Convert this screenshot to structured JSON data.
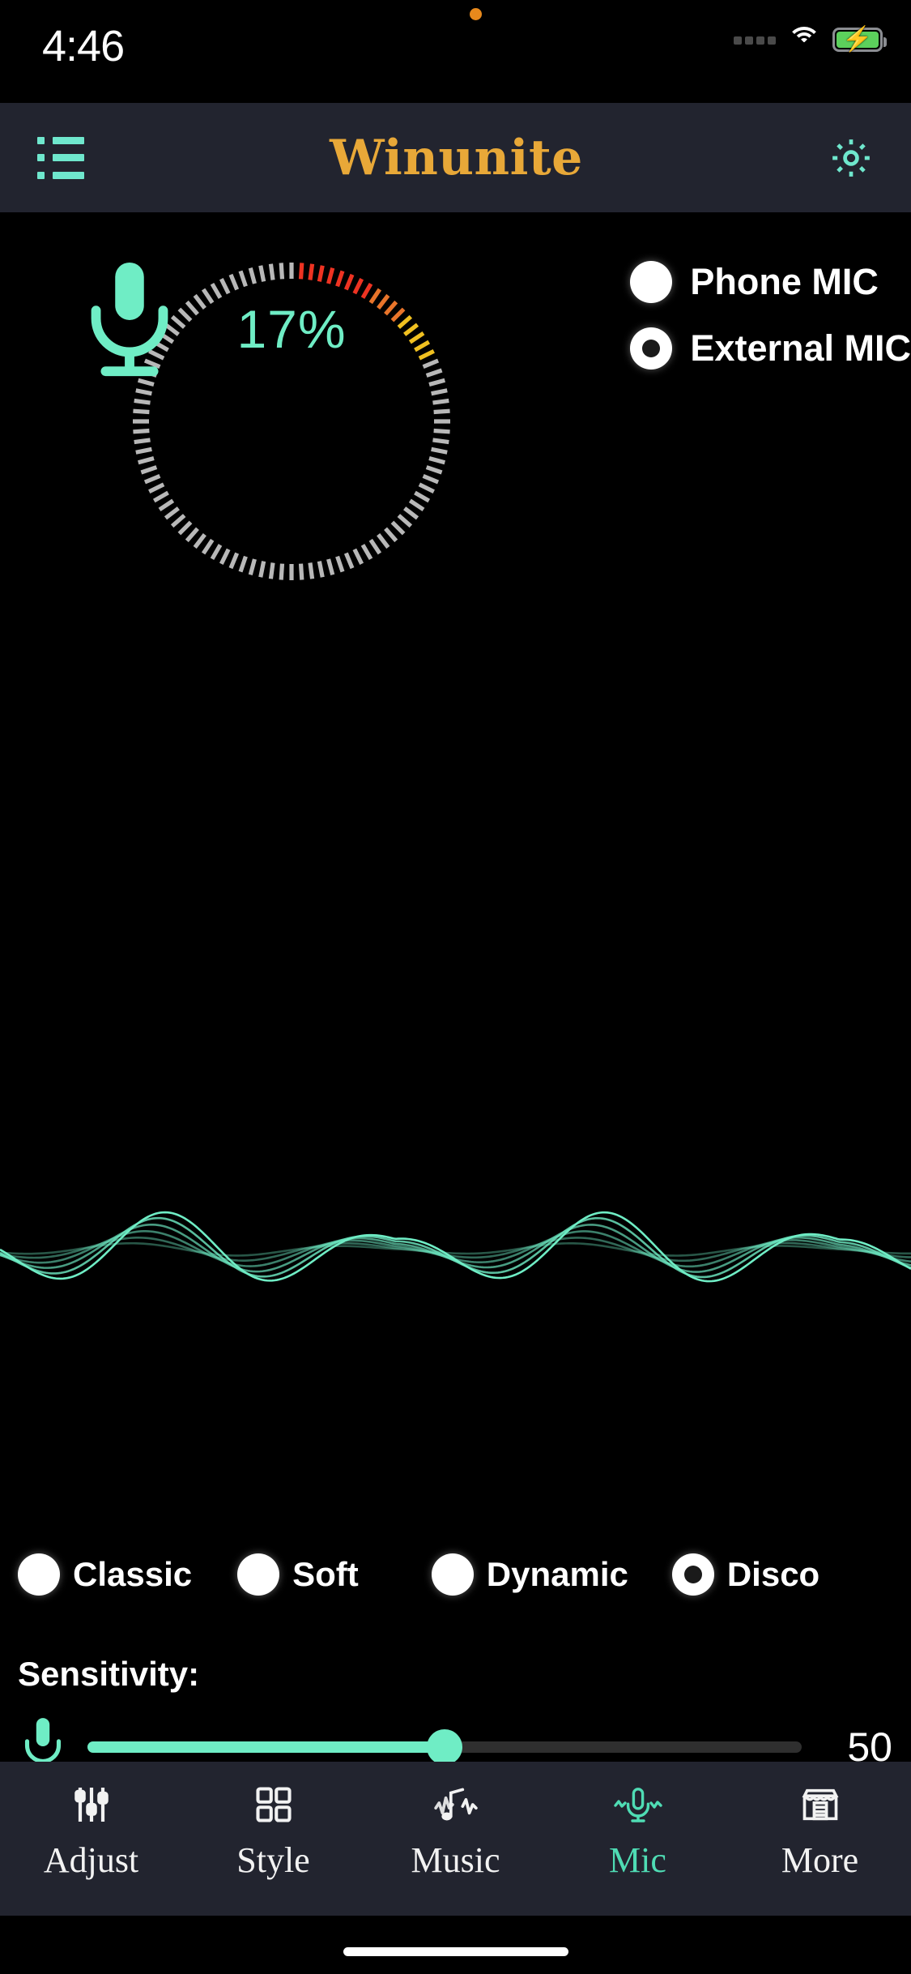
{
  "status_bar": {
    "time": "4:46",
    "recording_dot": "orange-dot-icon",
    "signal_icon": "signal-dots-icon",
    "wifi_icon": "wifi-icon",
    "battery_icon": "battery-charging-icon",
    "dot_color": "#e8891c",
    "battery_color": "#5cd05c"
  },
  "header": {
    "menu_icon": "list-menu-icon",
    "title": "Winunite",
    "settings_icon": "gear-icon",
    "title_color": "#e8a838",
    "icon_color": "#6fe7cd",
    "bg": "#22242f"
  },
  "mic_source": {
    "options": [
      {
        "label": "Phone MIC",
        "selected": false
      },
      {
        "label": "External MIC",
        "selected": true
      }
    ]
  },
  "gauge": {
    "percent_label": "17%",
    "percent_value": 17,
    "mic_icon": "microphone-icon",
    "accent": "#6fedc5",
    "tick_gray": "#b8b8b8",
    "tick_hot": "#ee3322",
    "tick_warm": "#f0c020"
  },
  "waveform": {
    "icon": "audio-waveform",
    "color": "#6fedc5"
  },
  "style_modes": {
    "options": [
      {
        "label": "Classic",
        "selected": false
      },
      {
        "label": "Soft",
        "selected": false
      },
      {
        "label": "Dynamic",
        "selected": false
      },
      {
        "label": "Disco",
        "selected": true
      }
    ]
  },
  "sensitivity": {
    "label": "Sensitivity:",
    "icon": "microphone-icon",
    "value": "50",
    "value_number": 50,
    "min": 0,
    "max": 100,
    "fill_color": "#6fedc5"
  },
  "tabbar": {
    "items": [
      {
        "label": "Adjust",
        "icon": "sliders-icon",
        "active": false
      },
      {
        "label": "Style",
        "icon": "grid-icon",
        "active": false
      },
      {
        "label": "Music",
        "icon": "music-note-wave-icon",
        "active": false
      },
      {
        "label": "Mic",
        "icon": "microphone-wave-icon",
        "active": true
      },
      {
        "label": "More",
        "icon": "store-icon",
        "active": false
      }
    ],
    "active_color": "#4fdcb4",
    "bg": "#22242f"
  }
}
